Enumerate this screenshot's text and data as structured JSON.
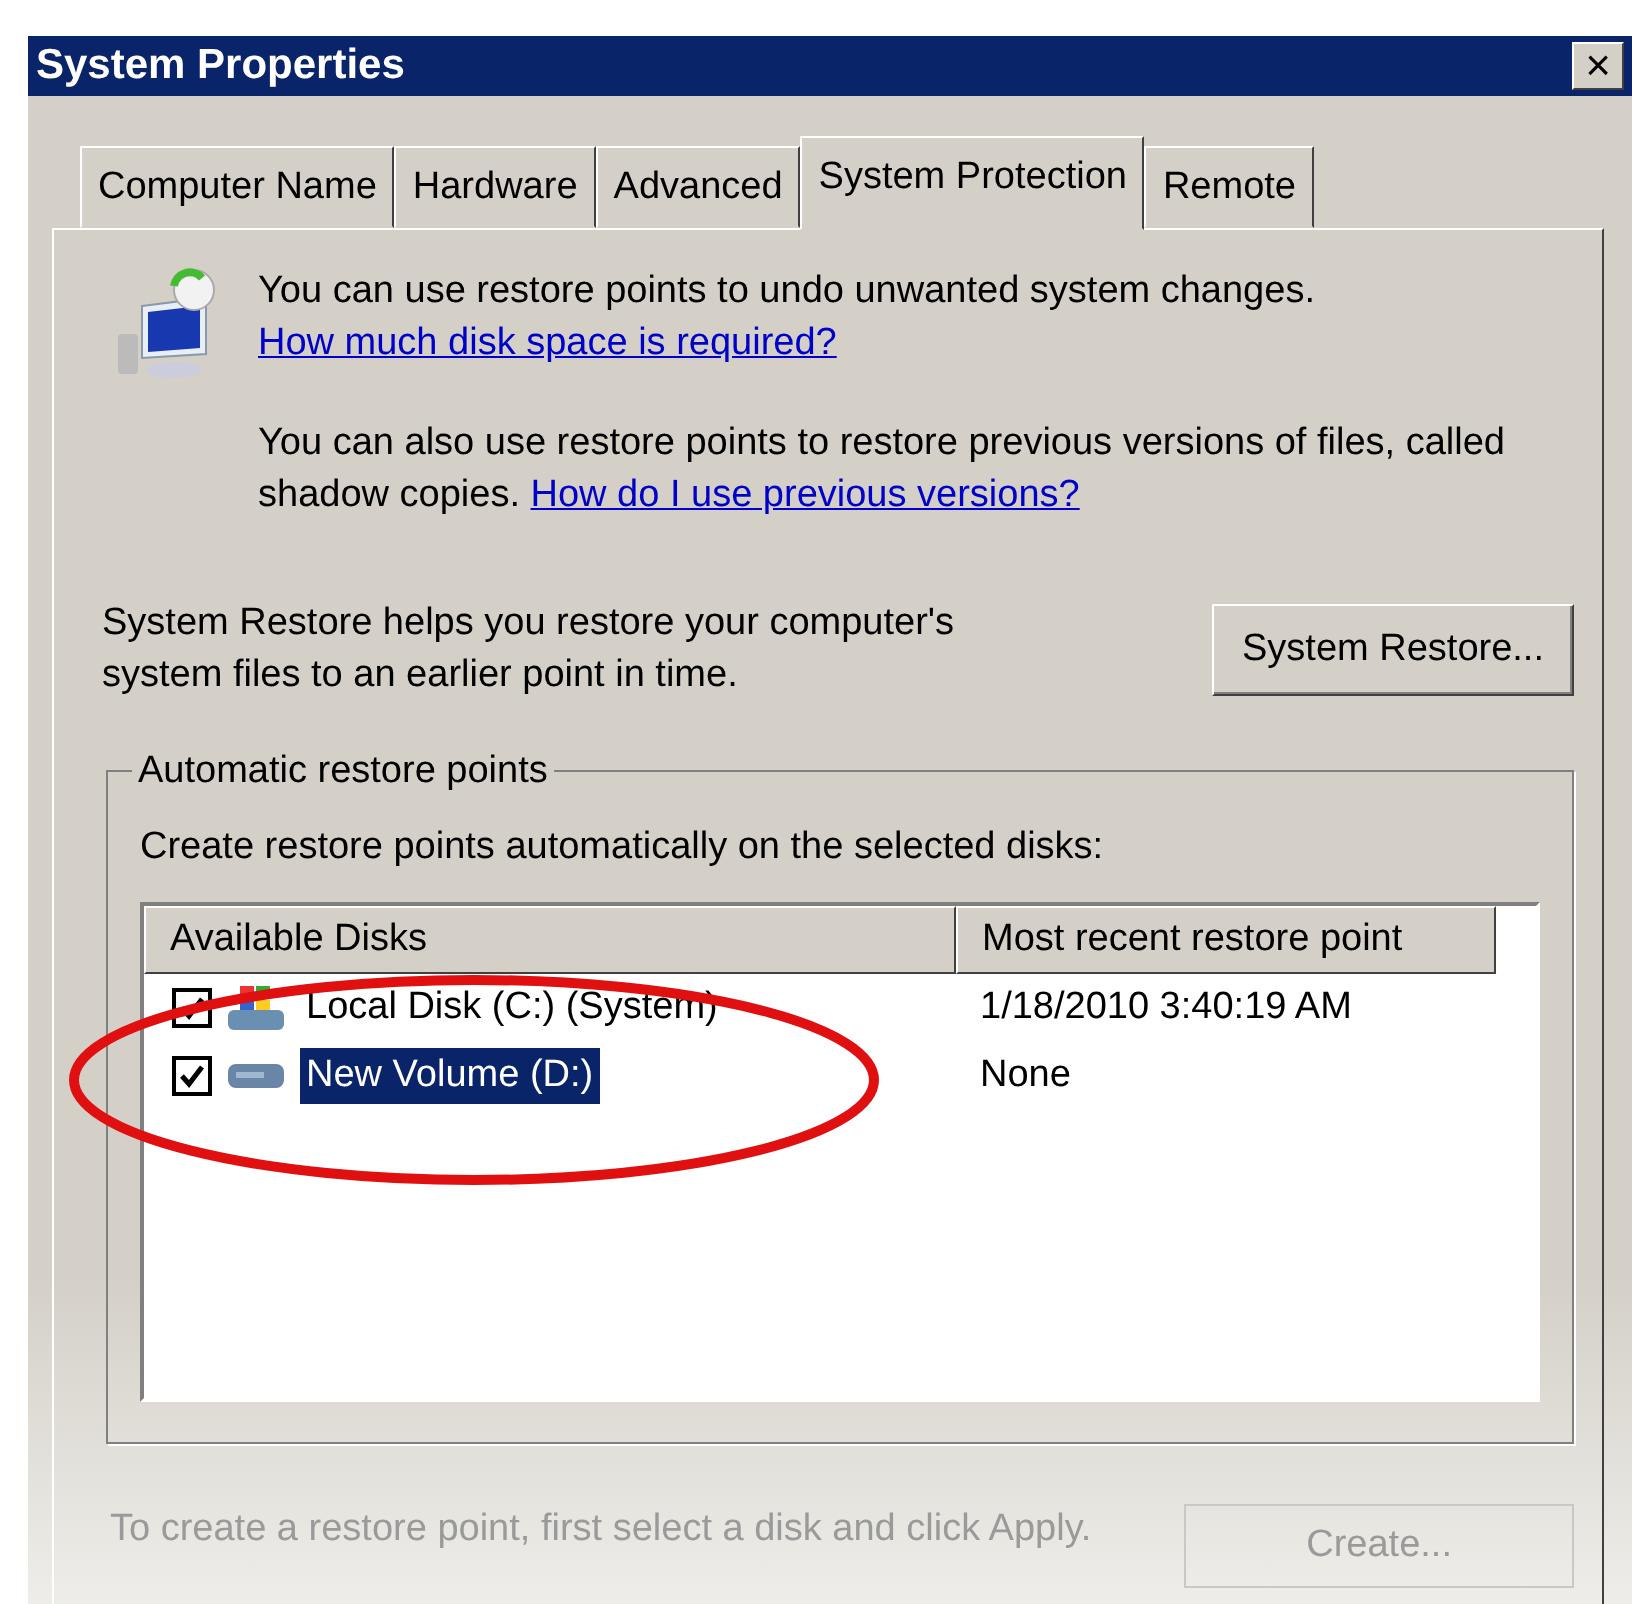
{
  "window": {
    "title": "System Properties",
    "close": "×"
  },
  "tabs": [
    {
      "label": "Computer Name",
      "selected": false
    },
    {
      "label": "Hardware",
      "selected": false
    },
    {
      "label": "Advanced",
      "selected": false
    },
    {
      "label": "System Protection",
      "selected": true
    },
    {
      "label": "Remote",
      "selected": false
    }
  ],
  "intro": [
    {
      "text": "You can use restore points to undo unwanted system changes.",
      "link": "How much disk space is required?"
    },
    {
      "text": "You can also use restore points to restore previous versions of files, called shadow copies.",
      "link": "How do I use previous versions?"
    }
  ],
  "restore": {
    "text": "System Restore helps you restore your computer's system files to an earlier point in time.",
    "button": "System Restore..."
  },
  "group": {
    "title": "Automatic restore points",
    "caption": "Create restore points automatically on the selected disks:",
    "columns": [
      "Available Disks",
      "Most recent restore point"
    ],
    "rows": [
      {
        "kind": "system",
        "name": "Local Disk (C:) (System)",
        "recent": "1/18/2010 3:40:19 AM",
        "checked": true,
        "selected": false
      },
      {
        "kind": "volume",
        "name": "New Volume (D:)",
        "recent": "None",
        "checked": true,
        "selected": true
      }
    ]
  },
  "footer": {
    "text": "To create a restore point, first select a disk and click Apply.",
    "button": "Create..."
  }
}
